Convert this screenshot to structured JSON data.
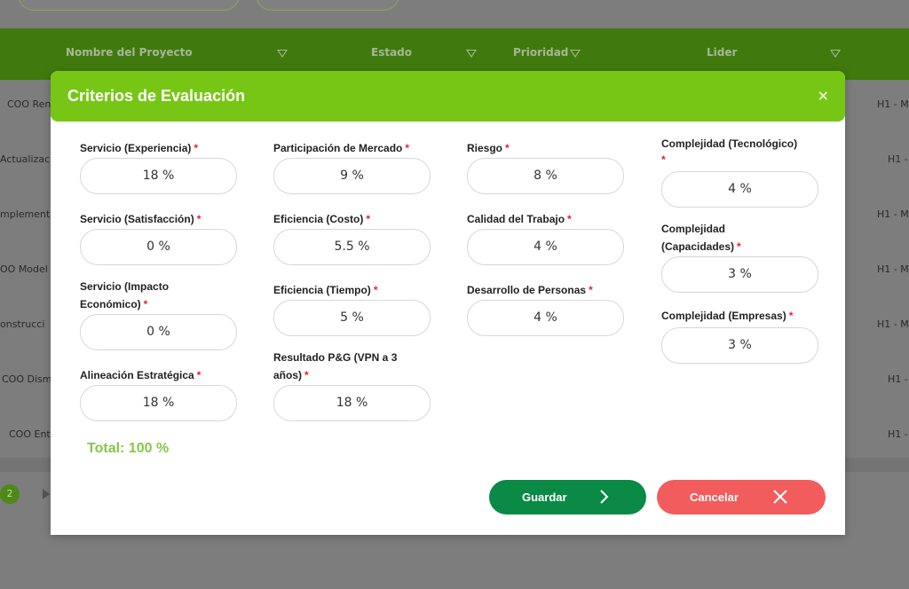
{
  "background": {
    "columns": [
      "Nombre del Proyecto",
      "Estado",
      "Prioridad",
      "Lider"
    ],
    "rows": [
      {
        "name": "COO Ren",
        "end": "H1 - M"
      },
      {
        "name": "Actualizaci",
        "end": "H1 -"
      },
      {
        "name": "mplement",
        "end": "H1 - M"
      },
      {
        "name": "OO Model",
        "end": "H1 - M"
      },
      {
        "name": "onstrucci",
        "end": "H1 - M"
      },
      {
        "name": "COO Dism",
        "end": "H1 -"
      },
      {
        "name": "COO Ent",
        "end": "H1 -"
      }
    ],
    "pagination_current": "2"
  },
  "modal": {
    "title": "Criterios de Evaluación",
    "close": "×",
    "fields": {
      "servicio_experiencia": {
        "label": "Servicio (Experiencia)",
        "value": "18 %"
      },
      "servicio_satisfaccion": {
        "label": "Servicio (Satisfacción)",
        "value": "0 %"
      },
      "servicio_impacto_1": {
        "label": "Servicio (Impacto",
        "label2": "Económico)",
        "value": "0 %"
      },
      "alineacion": {
        "label": "Alineación Estratégica",
        "value": "18 %"
      },
      "participacion": {
        "label": "Participación de Mercado",
        "value": "9 %"
      },
      "eficiencia_costo": {
        "label": "Eficiencia (Costo)",
        "value": "5.5 %"
      },
      "eficiencia_tiempo": {
        "label": "Eficiencia (Tiempo)",
        "value": "5 %"
      },
      "resultado": {
        "label": "Resultado P&G (VPN a 3",
        "label2": "años)",
        "value": "18 %"
      },
      "riesgo": {
        "label": "Riesgo",
        "value": "8 %"
      },
      "calidad": {
        "label": "Calidad del Trabajo",
        "value": "4 %"
      },
      "desarrollo": {
        "label": "Desarrollo de Personas",
        "value": "4 %"
      },
      "complejidad_tec": {
        "label": "Complejidad (Tecnológico)",
        "value": "4 %"
      },
      "complejidad_cap": {
        "label": "Complejidad",
        "label2": "(Capacidades)",
        "value": "3 %"
      },
      "complejidad_emp": {
        "label": "Complejidad (Empresas)",
        "value": "3 %"
      }
    },
    "required_mark": "*",
    "total": "Total: 100 %",
    "save_label": "Guardar",
    "cancel_label": "Cancelar"
  },
  "colors": {
    "header_green": "#77c616",
    "save_green": "#0a8a45",
    "cancel_red": "#f25c5c",
    "total_green": "#86c64b",
    "required_red": "#e8202a"
  }
}
